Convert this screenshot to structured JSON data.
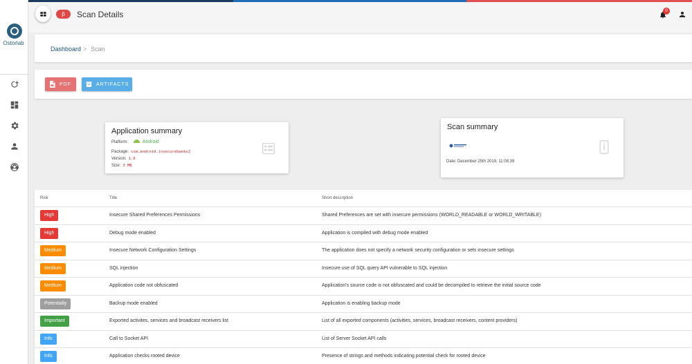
{
  "colors": {
    "high": "#e53935",
    "medium": "#fb8c00",
    "potentially": "#9e9e9e",
    "important": "#43a047",
    "info": "#42a5f5",
    "topline_dark": "#1b3a5c",
    "topline_blue": "#1e6fb8",
    "topline_red": "#e05050"
  },
  "brand": {
    "logo_text": "Ostorlab"
  },
  "header": {
    "beta_label": "β",
    "title": "Scan Details",
    "notifications_count": "0"
  },
  "breadcrumb": {
    "dashboard": "Dashboard",
    "separator": ">",
    "current": "Scan"
  },
  "actions": {
    "pdf_label": "PDF",
    "artifacts_label": "ARTIFACTS"
  },
  "app_summary": {
    "title": "Application summary",
    "platform_label": "Platform:",
    "platform_value": "Android",
    "package_label": "Package:",
    "package_value": "com.android.insecurebankv2",
    "version_label": "Version:",
    "version_value": "1.0",
    "size_label": "Size:",
    "size_value": "3 MB"
  },
  "scan_summary": {
    "title": "Scan summary",
    "date": "Date: December 25th 2019, 11:08:39"
  },
  "table": {
    "headers": [
      "Risk",
      "Title",
      "Short description"
    ],
    "rows": [
      {
        "risk": "High",
        "risk_color": "#e53935",
        "title": "Insecure Shared Preferences Permissions",
        "desc": "Shared Preferences are set with insecure permissions (WORLD_READABLE or WORLD_WRITABLE)"
      },
      {
        "risk": "High",
        "risk_color": "#e53935",
        "title": "Debug mode enabled",
        "desc": "Application is compiled with debug mode enabled"
      },
      {
        "risk": "Medium",
        "risk_color": "#fb8c00",
        "title": "Insecure Network Configuration Settings",
        "desc": "The application does not specify a network security configuration or sets insecure settings"
      },
      {
        "risk": "Medium",
        "risk_color": "#fb8c00",
        "title": "SQL injection",
        "desc": "Insecure use of SQL query API vulnerable to SQL injection"
      },
      {
        "risk": "Medium",
        "risk_color": "#fb8c00",
        "title": "Application code not obfuscated",
        "desc": "Application's source code is not obfuscated and could be decompiled to retrieve the initial source code"
      },
      {
        "risk": "Potentially",
        "risk_color": "#9e9e9e",
        "title": "Backup mode enabled",
        "desc": "Application is enabling backup mode"
      },
      {
        "risk": "Important",
        "risk_color": "#43a047",
        "title": "Exported activites, services and broadcast receivers list",
        "desc": "List of all exported components (activities, services, broadcast receivers, content providers)"
      },
      {
        "risk": "Info",
        "risk_color": "#42a5f5",
        "title": "Call to Socket API",
        "desc": "List of Server Socket API calls"
      },
      {
        "risk": "Info",
        "risk_color": "#42a5f5",
        "title": "Application checks rooted device",
        "desc": "Presence of strings and methods indicating potential check for rooted device"
      }
    ]
  }
}
